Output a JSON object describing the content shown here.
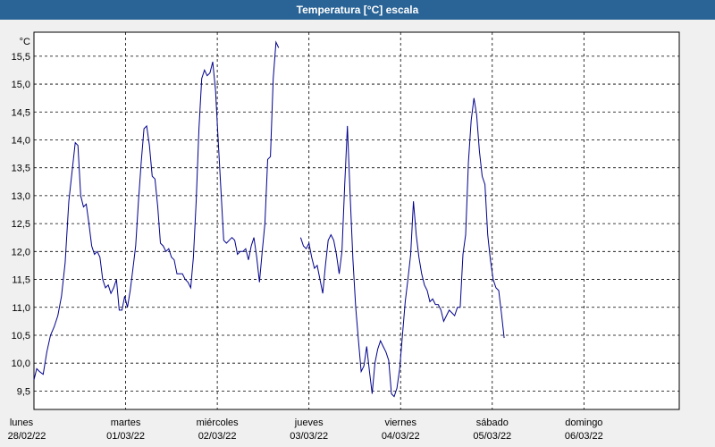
{
  "window": {
    "title": "Temperatura [°C] escala"
  },
  "colors": {
    "title_bar": "#2a6496",
    "plot_bg": "#ffffff",
    "page_bg": "#f0f0f0",
    "series_line": "#00008b",
    "grid": "#000000"
  },
  "chart_data": {
    "type": "line",
    "title": "Temperatura [°C] escala",
    "ylabel": "°C",
    "xlabel": "",
    "ylim": [
      9.17,
      15.93
    ],
    "xlim": [
      0,
      7.04
    ],
    "grid": true,
    "y_ticks": [
      "9,5",
      "10,0",
      "10,5",
      "11,0",
      "11,5",
      "12,0",
      "12,5",
      "13,0",
      "13,5",
      "14,0",
      "14,5",
      "15,0",
      "15,5"
    ],
    "y_tick_values": [
      9.5,
      10.0,
      10.5,
      11.0,
      11.5,
      12.0,
      12.5,
      13.0,
      13.5,
      14.0,
      14.5,
      15.0,
      15.5
    ],
    "days": [
      {
        "name": "lunes",
        "date": "28/02/22"
      },
      {
        "name": "martes",
        "date": "01/03/22"
      },
      {
        "name": "miércoles",
        "date": "02/03/22"
      },
      {
        "name": "jueves",
        "date": "03/03/22"
      },
      {
        "name": "viernes",
        "date": "04/03/22"
      },
      {
        "name": "sábado",
        "date": "05/03/22"
      },
      {
        "name": "domingo",
        "date": "06/03/22"
      }
    ],
    "series": [
      {
        "color": "#00008b",
        "segments": [
          [
            [
              0.0,
              9.7
            ],
            [
              0.03,
              9.9
            ],
            [
              0.06,
              9.85
            ],
            [
              0.1,
              9.8
            ],
            [
              0.14,
              10.2
            ],
            [
              0.18,
              10.5
            ],
            [
              0.22,
              10.65
            ],
            [
              0.26,
              10.85
            ],
            [
              0.3,
              11.2
            ],
            [
              0.34,
              11.8
            ],
            [
              0.38,
              12.9
            ],
            [
              0.42,
              13.5
            ],
            [
              0.45,
              13.95
            ],
            [
              0.48,
              13.9
            ],
            [
              0.51,
              13.0
            ],
            [
              0.54,
              12.8
            ],
            [
              0.57,
              12.85
            ],
            [
              0.6,
              12.5
            ],
            [
              0.63,
              12.1
            ],
            [
              0.66,
              11.95
            ],
            [
              0.69,
              12.0
            ],
            [
              0.72,
              11.9
            ],
            [
              0.75,
              11.5
            ],
            [
              0.78,
              11.35
            ],
            [
              0.81,
              11.4
            ],
            [
              0.84,
              11.25
            ],
            [
              0.87,
              11.35
            ],
            [
              0.9,
              11.5
            ],
            [
              0.93,
              10.95
            ],
            [
              0.96,
              10.95
            ],
            [
              0.99,
              11.2
            ],
            [
              1.02,
              11.0
            ],
            [
              1.05,
              11.3
            ],
            [
              1.08,
              11.7
            ],
            [
              1.11,
              12.1
            ],
            [
              1.14,
              12.9
            ],
            [
              1.17,
              13.6
            ],
            [
              1.2,
              14.2
            ],
            [
              1.23,
              14.25
            ],
            [
              1.26,
              13.9
            ],
            [
              1.29,
              13.35
            ],
            [
              1.32,
              13.3
            ],
            [
              1.35,
              12.8
            ],
            [
              1.38,
              12.15
            ],
            [
              1.41,
              12.1
            ],
            [
              1.44,
              12.0
            ],
            [
              1.47,
              12.05
            ],
            [
              1.5,
              11.9
            ],
            [
              1.53,
              11.85
            ],
            [
              1.56,
              11.6
            ],
            [
              1.59,
              11.6
            ],
            [
              1.62,
              11.6
            ],
            [
              1.65,
              11.5
            ],
            [
              1.68,
              11.45
            ],
            [
              1.71,
              11.35
            ],
            [
              1.74,
              11.9
            ],
            [
              1.77,
              12.9
            ],
            [
              1.8,
              14.2
            ],
            [
              1.83,
              15.1
            ],
            [
              1.86,
              15.25
            ],
            [
              1.89,
              15.15
            ],
            [
              1.92,
              15.2
            ],
            [
              1.95,
              15.4
            ],
            [
              1.98,
              14.9
            ],
            [
              2.01,
              14.0
            ],
            [
              2.04,
              13.1
            ],
            [
              2.07,
              12.2
            ],
            [
              2.1,
              12.15
            ],
            [
              2.13,
              12.2
            ],
            [
              2.16,
              12.25
            ],
            [
              2.19,
              12.2
            ],
            [
              2.22,
              11.95
            ],
            [
              2.25,
              12.0
            ],
            [
              2.28,
              12.0
            ],
            [
              2.31,
              12.05
            ],
            [
              2.34,
              11.85
            ],
            [
              2.37,
              12.1
            ],
            [
              2.4,
              12.25
            ],
            [
              2.43,
              11.9
            ],
            [
              2.46,
              11.45
            ],
            [
              2.49,
              12.0
            ],
            [
              2.52,
              12.5
            ],
            [
              2.55,
              13.65
            ],
            [
              2.58,
              13.7
            ],
            [
              2.61,
              15.1
            ],
            [
              2.64,
              15.75
            ],
            [
              2.67,
              15.65
            ]
          ],
          [
            [
              2.91,
              12.25
            ],
            [
              2.94,
              12.1
            ],
            [
              2.97,
              12.05
            ],
            [
              3.0,
              12.15
            ],
            [
              3.03,
              11.9
            ],
            [
              3.06,
              11.7
            ],
            [
              3.09,
              11.75
            ],
            [
              3.12,
              11.5
            ],
            [
              3.15,
              11.25
            ],
            [
              3.18,
              11.75
            ],
            [
              3.21,
              12.2
            ],
            [
              3.24,
              12.3
            ],
            [
              3.27,
              12.2
            ],
            [
              3.3,
              11.95
            ],
            [
              3.33,
              11.6
            ],
            [
              3.36,
              12.0
            ],
            [
              3.39,
              13.2
            ],
            [
              3.42,
              14.25
            ],
            [
              3.45,
              13.0
            ],
            [
              3.48,
              11.85
            ],
            [
              3.51,
              11.0
            ],
            [
              3.54,
              10.4
            ],
            [
              3.57,
              9.85
            ],
            [
              3.6,
              9.95
            ],
            [
              3.63,
              10.3
            ],
            [
              3.66,
              9.85
            ],
            [
              3.69,
              9.45
            ],
            [
              3.72,
              10.0
            ],
            [
              3.75,
              10.25
            ],
            [
              3.78,
              10.4
            ],
            [
              3.81,
              10.3
            ],
            [
              3.84,
              10.2
            ],
            [
              3.87,
              10.05
            ],
            [
              3.9,
              9.45
            ],
            [
              3.93,
              9.4
            ],
            [
              3.96,
              9.55
            ],
            [
              3.99,
              9.9
            ],
            [
              4.02,
              10.5
            ],
            [
              4.05,
              11.1
            ],
            [
              4.08,
              11.5
            ],
            [
              4.11,
              11.95
            ],
            [
              4.14,
              12.9
            ],
            [
              4.17,
              12.3
            ],
            [
              4.2,
              11.9
            ],
            [
              4.23,
              11.6
            ],
            [
              4.26,
              11.4
            ],
            [
              4.29,
              11.3
            ],
            [
              4.32,
              11.1
            ],
            [
              4.35,
              11.15
            ],
            [
              4.38,
              11.05
            ],
            [
              4.41,
              11.05
            ],
            [
              4.44,
              10.95
            ],
            [
              4.47,
              10.75
            ],
            [
              4.5,
              10.85
            ],
            [
              4.53,
              10.95
            ],
            [
              4.56,
              10.9
            ],
            [
              4.59,
              10.85
            ],
            [
              4.62,
              11.0
            ],
            [
              4.65,
              11.0
            ],
            [
              4.68,
              11.95
            ],
            [
              4.71,
              12.3
            ],
            [
              4.74,
              13.6
            ],
            [
              4.77,
              14.35
            ],
            [
              4.8,
              14.75
            ],
            [
              4.83,
              14.45
            ],
            [
              4.86,
              13.8
            ],
            [
              4.89,
              13.35
            ],
            [
              4.92,
              13.2
            ],
            [
              4.95,
              12.3
            ],
            [
              4.98,
              11.85
            ],
            [
              5.01,
              11.5
            ],
            [
              5.04,
              11.35
            ],
            [
              5.07,
              11.3
            ],
            [
              5.1,
              10.9
            ],
            [
              5.13,
              10.45
            ]
          ]
        ]
      }
    ]
  }
}
